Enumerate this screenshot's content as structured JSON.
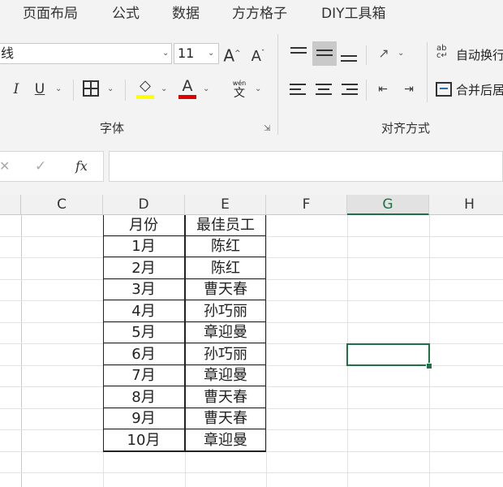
{
  "tabs": [
    "页面布局",
    "公式",
    "数据",
    "方方格子",
    "DIY工具箱"
  ],
  "font": {
    "name_value": "线",
    "size_value": "11",
    "grow_label": "A",
    "shrink_label": "A",
    "italic_label": "I",
    "underline_label": "U",
    "fill_label": "◇",
    "color_label": "A",
    "phonetic_top": "wén",
    "phonetic_bottom": "文",
    "group_label": "字体",
    "fill_color": "#ffff00",
    "font_color": "#e00000"
  },
  "align": {
    "wrap_label": "自动换行",
    "merge_label": "合并后居",
    "group_label": "对齐方式"
  },
  "formula": {
    "cancel": "✕",
    "enter": "✓",
    "fx": "fx",
    "value": ""
  },
  "columns": [
    "C",
    "D",
    "E",
    "F",
    "G",
    "H"
  ],
  "selected_column": "G",
  "table": {
    "header": [
      "月份",
      "最佳员工"
    ],
    "rows": [
      [
        "1月",
        "陈红"
      ],
      [
        "2月",
        "陈红"
      ],
      [
        "3月",
        "曹天春"
      ],
      [
        "4月",
        "孙巧丽"
      ],
      [
        "5月",
        "章迎曼"
      ],
      [
        "6月",
        "孙巧丽"
      ],
      [
        "7月",
        "章迎曼"
      ],
      [
        "8月",
        "曹天春"
      ],
      [
        "9月",
        "曹天春"
      ],
      [
        "10月",
        "章迎曼"
      ]
    ]
  },
  "accent": "#1e7145"
}
